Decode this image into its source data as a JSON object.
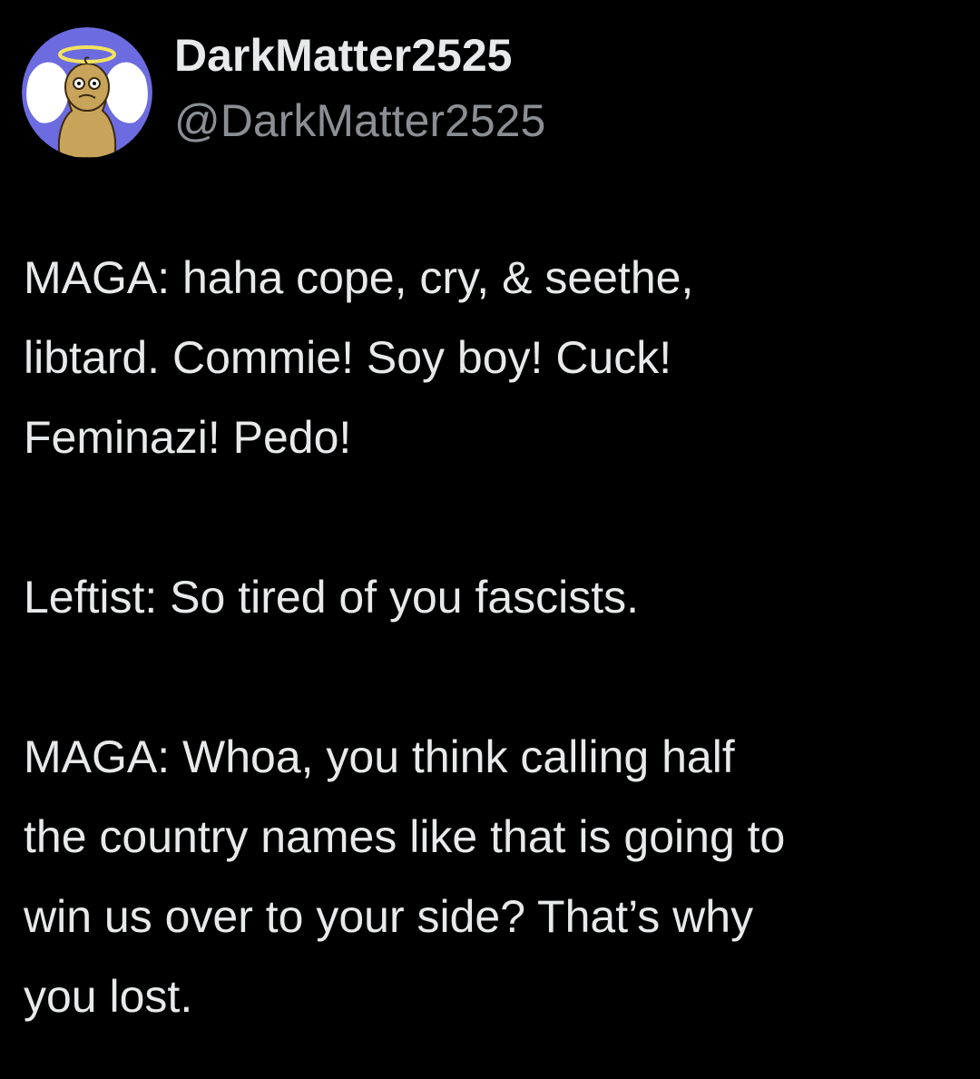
{
  "tweet": {
    "author": {
      "display_name": "DarkMatter2525",
      "handle": "@DarkMatter2525",
      "avatar_icon": "angel-character-avatar"
    },
    "paragraphs": [
      [
        "MAGA: haha cope, cry, & seethe,",
        "libtard. Commie! Soy boy! Cuck!",
        "Feminazi! Pedo!"
      ],
      [
        "Leftist: So tired of you fascists."
      ],
      [
        "MAGA: Whoa, you think calling half",
        "the country names like that is going to",
        "win us over to your side? That’s why",
        "you lost."
      ]
    ]
  },
  "colors": {
    "background": "#000000",
    "text": "#e7e9ea",
    "handle": "#8b8f94"
  }
}
